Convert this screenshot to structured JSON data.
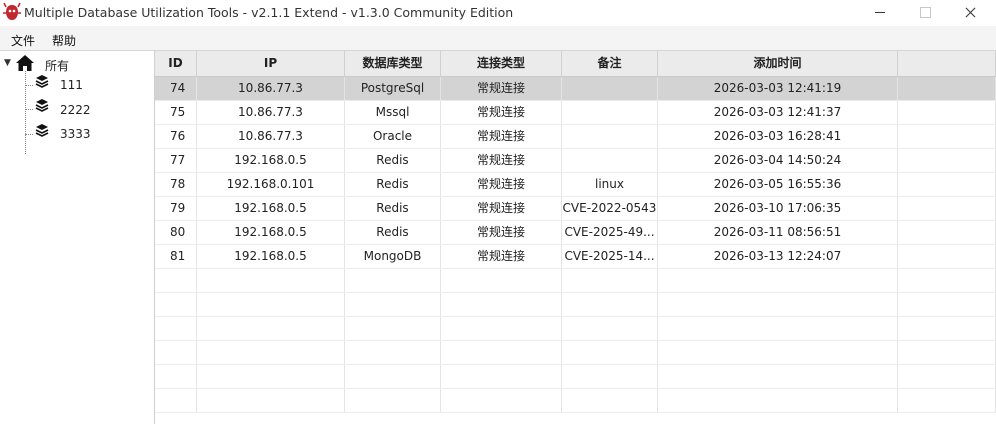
{
  "window": {
    "title": "Multiple Database Utilization Tools - v2.1.1 Extend - v1.3.0 Community Edition"
  },
  "menu": {
    "file_label": "文件",
    "help_label": "帮助"
  },
  "tree": {
    "root_label": "所有",
    "items": [
      {
        "label": "111"
      },
      {
        "label": "2222"
      },
      {
        "label": "3333"
      }
    ]
  },
  "table": {
    "headers": {
      "id": "ID",
      "ip": "IP",
      "db_type": "数据库类型",
      "conn_type": "连接类型",
      "note": "备注",
      "added_time": "添加时间"
    },
    "rows": [
      {
        "id": "74",
        "ip": "10.86.77.3",
        "db_type": "PostgreSql",
        "conn_type": "常规连接",
        "note": "",
        "added_time": "2026-03-03 12:41:19"
      },
      {
        "id": "75",
        "ip": "10.86.77.3",
        "db_type": "Mssql",
        "conn_type": "常规连接",
        "note": "",
        "added_time": "2026-03-03 12:41:37"
      },
      {
        "id": "76",
        "ip": "10.86.77.3",
        "db_type": "Oracle",
        "conn_type": "常规连接",
        "note": "",
        "added_time": "2026-03-03 16:28:41"
      },
      {
        "id": "77",
        "ip": "192.168.0.5",
        "db_type": "Redis",
        "conn_type": "常规连接",
        "note": "",
        "added_time": "2026-03-04 14:50:24"
      },
      {
        "id": "78",
        "ip": "192.168.0.101",
        "db_type": "Redis",
        "conn_type": "常规连接",
        "note": "linux",
        "added_time": "2026-03-05 16:55:36"
      },
      {
        "id": "79",
        "ip": "192.168.0.5",
        "db_type": "Redis",
        "conn_type": "常规连接",
        "note": "CVE-2022-0543",
        "added_time": "2026-03-10 17:06:35"
      },
      {
        "id": "80",
        "ip": "192.168.0.5",
        "db_type": "Redis",
        "conn_type": "常规连接",
        "note": "CVE-2025-49...",
        "added_time": "2026-03-11 08:56:51"
      },
      {
        "id": "81",
        "ip": "192.168.0.5",
        "db_type": "MongoDB",
        "conn_type": "常规连接",
        "note": "CVE-2025-14...",
        "added_time": "2026-03-13 12:24:07"
      }
    ],
    "selected_row_id": "74"
  },
  "colors": {
    "selected_row": "#d3d3d3",
    "header_bg": "#ebebeb",
    "app_icon": "#c0282d"
  },
  "icons": {
    "app": "red-bug-icon",
    "tree_root": "home-icon",
    "tree_child": "layers-icon"
  }
}
